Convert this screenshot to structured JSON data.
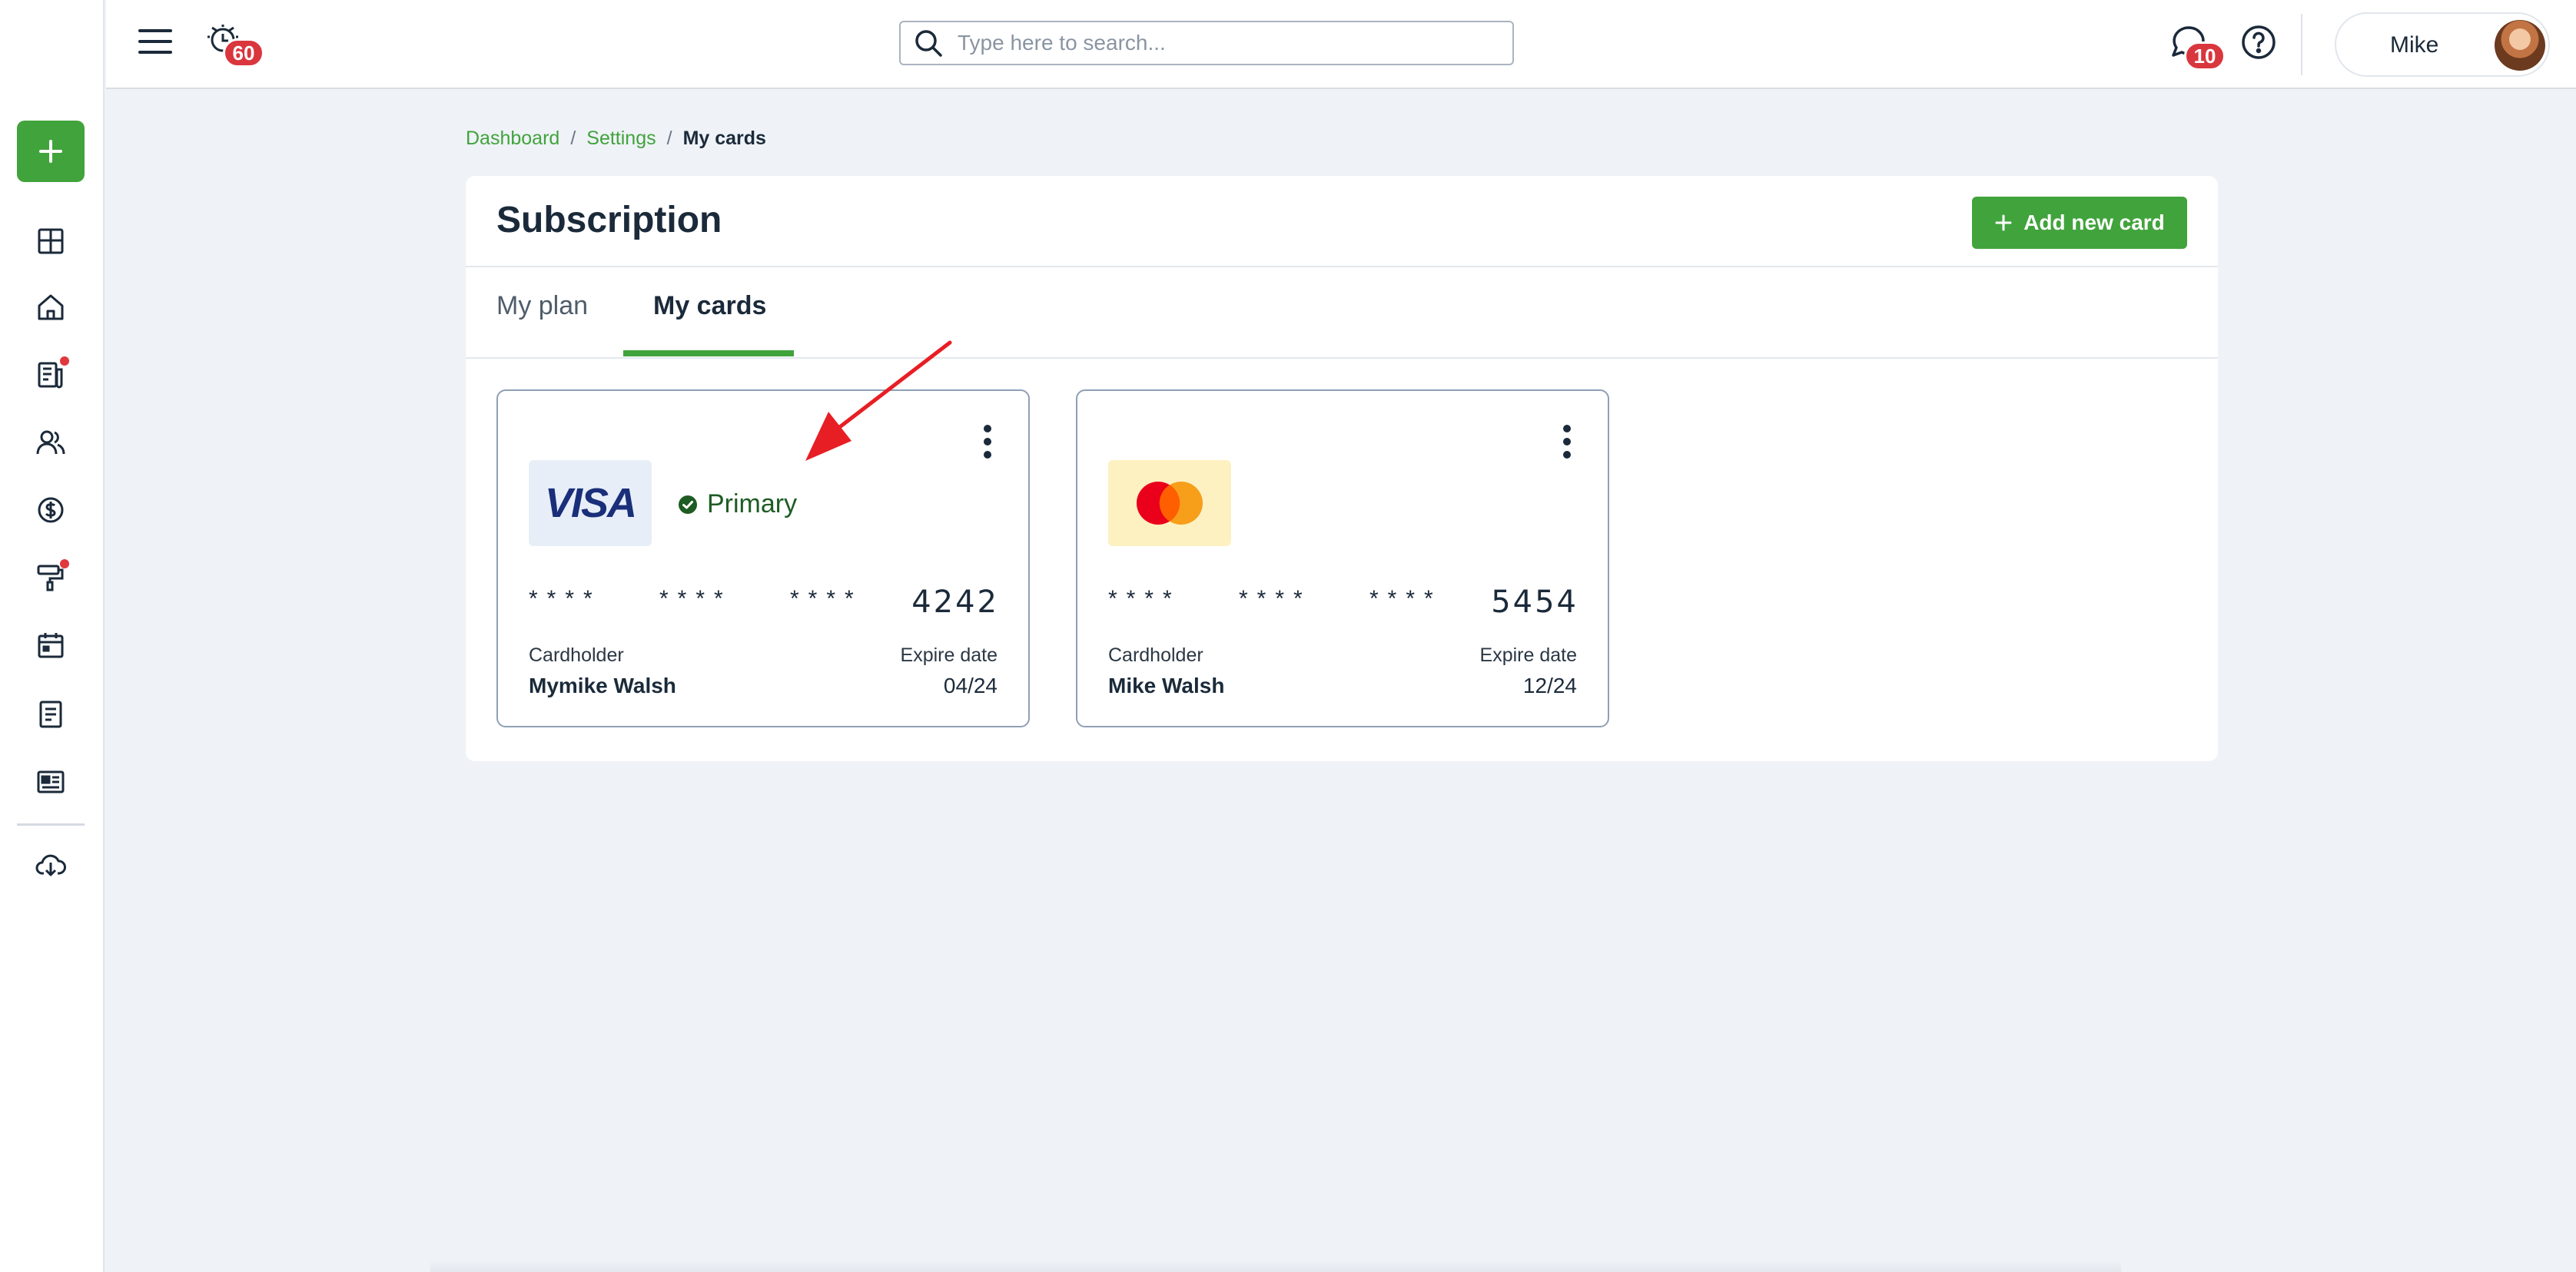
{
  "topbar": {
    "alarm_badge": "60",
    "search_placeholder": "Type here to search...",
    "chat_badge": "10",
    "user_name": "Mike"
  },
  "sidebar": {
    "items": [
      {
        "icon": "dashboard-grid-icon",
        "dot": false
      },
      {
        "icon": "home-icon",
        "dot": false
      },
      {
        "icon": "reports-icon",
        "dot": true
      },
      {
        "icon": "users-icon",
        "dot": false
      },
      {
        "icon": "billing-dollar-icon",
        "dot": false
      },
      {
        "icon": "paint-roller-icon",
        "dot": true
      },
      {
        "icon": "calendar-icon",
        "dot": false
      },
      {
        "icon": "document-icon",
        "dot": false
      },
      {
        "icon": "news-icon",
        "dot": false
      },
      {
        "icon": "cloud-download-icon",
        "dot": false
      }
    ]
  },
  "breadcrumb": {
    "items": [
      "Dashboard",
      "Settings"
    ],
    "current": "My cards",
    "separator": "/"
  },
  "panel": {
    "title": "Subscription",
    "add_button_label": "Add new card",
    "tabs": [
      {
        "label": "My plan",
        "active": false
      },
      {
        "label": "My cards",
        "active": true
      }
    ]
  },
  "cards": [
    {
      "brand": "VISA",
      "primary_label": "Primary",
      "masked_groups": [
        "****",
        "****",
        "****"
      ],
      "last4": "4242",
      "cardholder_label": "Cardholder",
      "cardholder": "Mymike Walsh",
      "expire_label": "Expire date",
      "expire": "04/24"
    },
    {
      "brand_icon": "mastercard-logo",
      "masked_groups": [
        "****",
        "****",
        "****"
      ],
      "last4": "5454",
      "cardholder_label": "Cardholder",
      "cardholder": "Mike Walsh",
      "expire_label": "Expire date",
      "expire": "12/24"
    }
  ],
  "colors": {
    "accent": "#41a33c",
    "badge": "#d9363e",
    "primary_text": "#1d5c23",
    "annotation_arrow": "#e81e25"
  }
}
